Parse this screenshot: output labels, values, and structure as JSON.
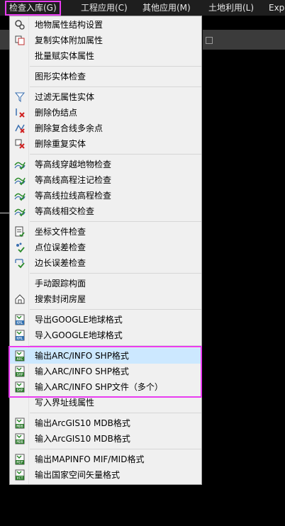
{
  "menubar": {
    "items": [
      {
        "label": "检查入库(G)"
      },
      {
        "label": "工程应用(C)"
      },
      {
        "label": "其他应用(M)"
      },
      {
        "label": "土地利用(L)"
      },
      {
        "label": "Exp"
      }
    ]
  },
  "menu": {
    "groups": [
      [
        {
          "label": "地物属性结构设置",
          "icon": "gear-icon"
        },
        {
          "label": "复制实体附加属性",
          "icon": "copy-icon"
        },
        {
          "label": "批量赋实体属性",
          "icon": ""
        }
      ],
      [
        {
          "label": "图形实体检查",
          "icon": ""
        }
      ],
      [
        {
          "label": "过滤无属性实体",
          "icon": "filter-icon"
        },
        {
          "label": "删除伪结点",
          "icon": "delete-node-icon"
        },
        {
          "label": "删除复合线多余点",
          "icon": "polyline-icon"
        },
        {
          "label": "删除重复实体",
          "icon": "delete-duplicate-icon"
        }
      ],
      [
        {
          "label": "等高线穿越地物检查",
          "icon": "contour-cross-icon"
        },
        {
          "label": "等高线高程注记检查",
          "icon": "contour-annot-icon"
        },
        {
          "label": "等高线拉线高程检查",
          "icon": "contour-pull-icon"
        },
        {
          "label": "等高线相交检查",
          "icon": "contour-intersect-icon"
        }
      ],
      [
        {
          "label": "坐标文件检查",
          "icon": "coord-file-icon"
        },
        {
          "label": "点位误差检查",
          "icon": "point-error-icon"
        },
        {
          "label": "边长误差检查",
          "icon": "edge-error-icon"
        }
      ],
      [
        {
          "label": "手动跟踪构面",
          "icon": ""
        },
        {
          "label": "搜索封闭房屋",
          "icon": "house-icon"
        }
      ],
      [
        {
          "label": "导出GOOGLE地球格式",
          "icon": "kml-export-icon",
          "badge": "KML"
        },
        {
          "label": "导入GOOGLE地球格式",
          "icon": "kml-import-icon",
          "badge": "KML"
        }
      ],
      [
        {
          "label": "输出ARC/INFO SHP格式",
          "icon": "shp-export-icon",
          "badge": "ARC",
          "highlight": true
        },
        {
          "label": "输入ARC/INFO SHP格式",
          "icon": "shp-import-icon",
          "badge": "SHP"
        },
        {
          "label": "输入ARC/INFO SHP文件（多个）",
          "icon": "shp-import-multi-icon",
          "badge": "SHP"
        },
        {
          "label": "写入界址线属性",
          "icon": ""
        }
      ],
      [
        {
          "label": "输出ArcGIS10 MDB格式",
          "icon": "mdb-export-icon",
          "badge": "MDB"
        },
        {
          "label": "输入ArcGIS10 MDB格式",
          "icon": "mdb-import-icon",
          "badge": "MDB"
        }
      ],
      [
        {
          "label": "输出MAPINFO MIF/MID格式",
          "icon": "mif-export-icon",
          "badge": "MIF"
        },
        {
          "label": "输出国家空间矢量格式",
          "icon": "vct-export-icon",
          "badge": "VCT"
        }
      ]
    ]
  },
  "colors": {
    "highlight_box": "#e83cf0",
    "hover_row": "#cce8ff",
    "menu_bg": "#f0f0f0",
    "menubar_bg": "#1e1e1e"
  }
}
